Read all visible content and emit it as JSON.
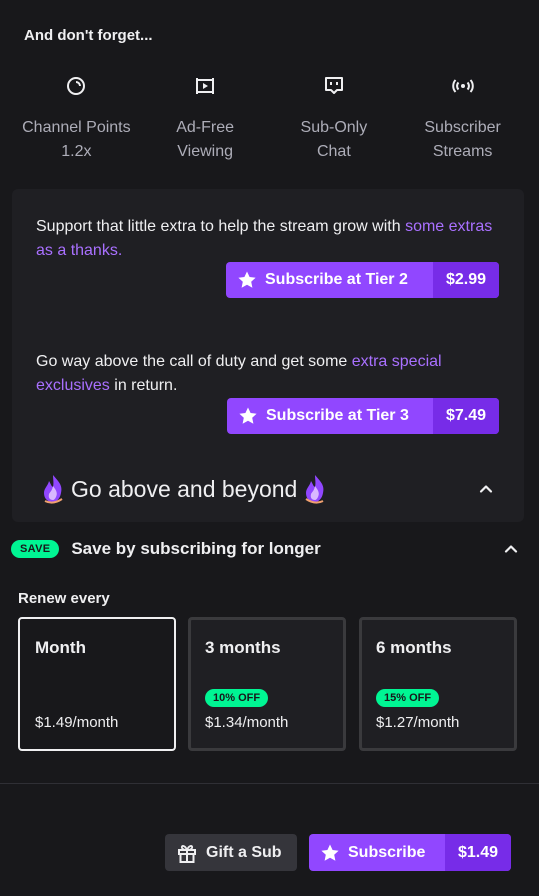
{
  "benefits": {
    "heading": "And don't forget...",
    "items": [
      {
        "icon": "channel-points-icon",
        "line1": "Channel Points",
        "line2": "1.2x"
      },
      {
        "icon": "ad-free-icon",
        "line1": "Ad-Free",
        "line2": "Viewing"
      },
      {
        "icon": "sub-only-chat-icon",
        "line1": "Sub-Only",
        "line2": "Chat"
      },
      {
        "icon": "broadcast-icon",
        "line1": "Subscriber",
        "line2": "Streams"
      }
    ]
  },
  "tiers": {
    "tier2": {
      "text": "Support that little extra to help the stream grow with ",
      "accent": "some extras as a thanks.",
      "button_label": "Subscribe at Tier 2",
      "price": "$2.99"
    },
    "tier3": {
      "text": "Go way above the call of duty and get some ",
      "accent": "extra special exclusives",
      "text_after": " in return.",
      "button_label": "Subscribe at Tier 3",
      "price": "$7.49"
    },
    "collapse_title": "Go above and beyond"
  },
  "save": {
    "badge": "SAVE",
    "title": "Save by subscribing for longer",
    "renew_label": "Renew every",
    "options": [
      {
        "title": "Month",
        "badge": "",
        "price": "$1.49/month",
        "selected": true
      },
      {
        "title": "3 months",
        "badge": "10% OFF",
        "price": "$1.34/month",
        "selected": false
      },
      {
        "title": "6 months",
        "badge": "15% OFF",
        "price": "$1.27/month",
        "selected": false
      }
    ]
  },
  "footer": {
    "gift_label": "Gift a Sub",
    "subscribe_label": "Subscribe",
    "subscribe_price": "$1.49"
  },
  "colors": {
    "background": "#18181b",
    "card": "#1f1f23",
    "accent_purple": "#9147ff",
    "accent_purple_dark": "#772ce8",
    "link_purple": "#a970ff",
    "save_green": "#00f593"
  }
}
